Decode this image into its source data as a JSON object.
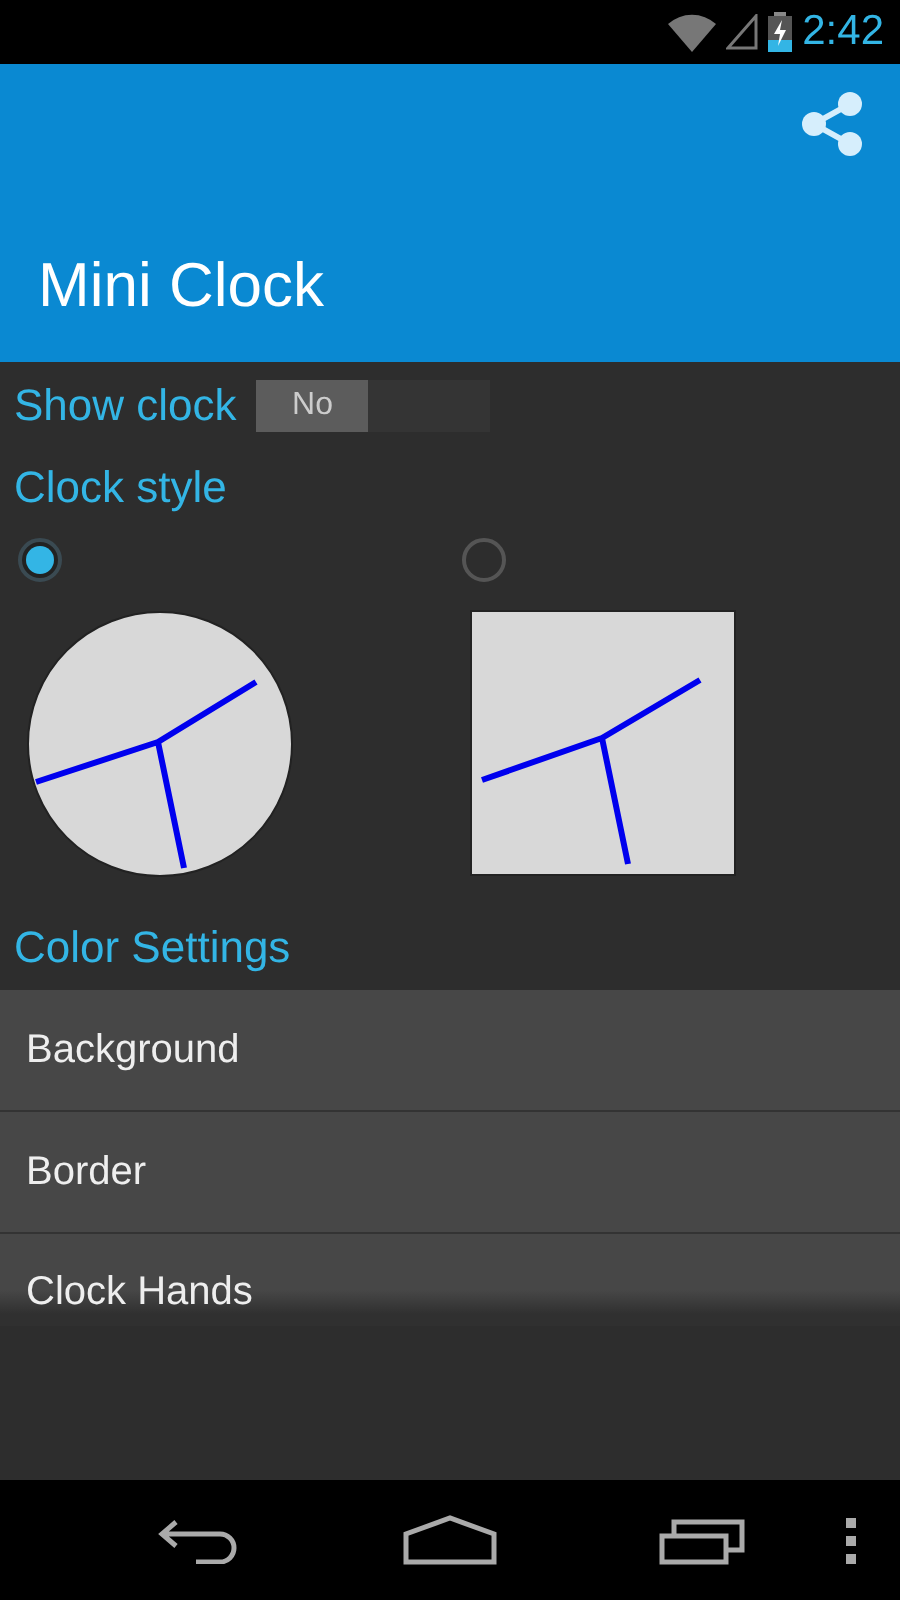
{
  "status_bar": {
    "time": "2:42"
  },
  "app_bar": {
    "title": "Mini Clock"
  },
  "show_clock": {
    "label": "Show clock",
    "toggle": "No",
    "on": false
  },
  "clock_style": {
    "label": "Clock style",
    "options": [
      {
        "kind": "round",
        "selected": true
      },
      {
        "kind": "square",
        "selected": false
      }
    ]
  },
  "color_settings": {
    "label": "Color Settings",
    "items": [
      "Background",
      "Border",
      "Clock Hands"
    ]
  }
}
